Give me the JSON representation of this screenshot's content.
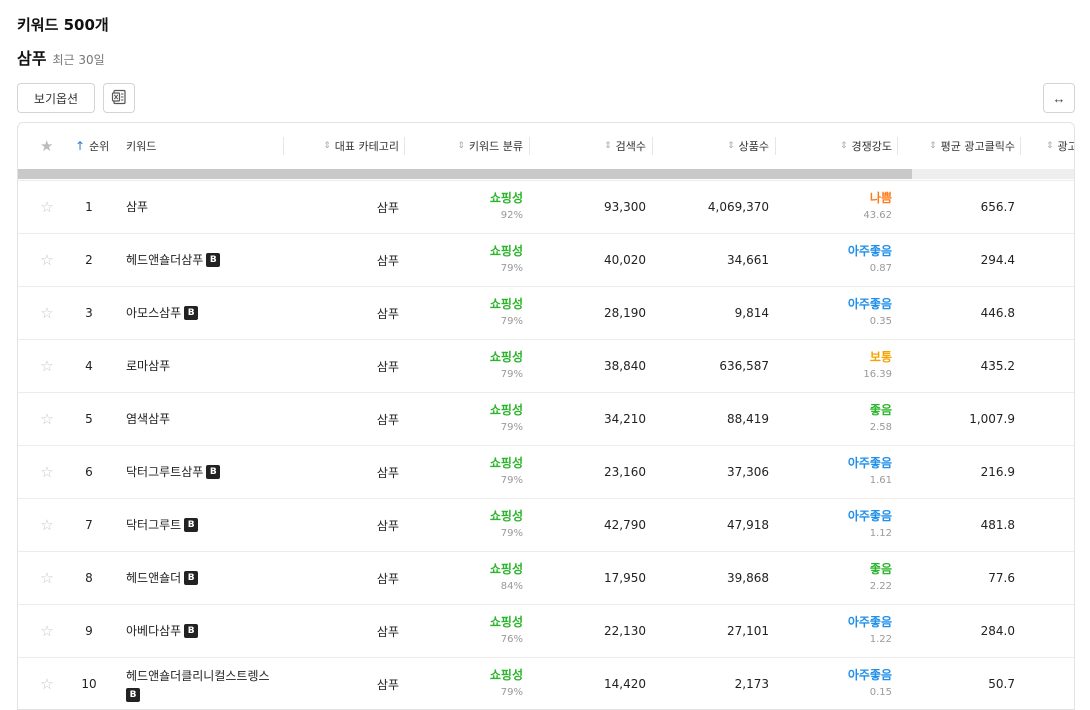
{
  "header": {
    "title": "키워드 500개",
    "keyword": "삼푸",
    "period": "최근 30일"
  },
  "toolbar": {
    "view_options_label": "보기옵션",
    "excel_icon": "excel-icon",
    "expand_label": "↔"
  },
  "columns": {
    "rank": "순위",
    "keyword": "키워드",
    "category": "대표 카테고리",
    "classification": "키워드 분류",
    "search_count": "검색수",
    "product_count": "상품수",
    "competition": "경쟁강도",
    "avg_ad_clicks": "평균 광고클릭수",
    "truncated": "광고"
  },
  "colors": {
    "shopping": "#2bb52b",
    "bad": "#ff7a1a",
    "normal": "#f5a300",
    "good": "#2bb52b",
    "very_good": "#1f8fea",
    "sort_active": "#1f7ae0"
  },
  "scrollbar_fraction": 0.845,
  "rows": [
    {
      "rank": "1",
      "keyword": "삼푸",
      "badge": "",
      "category": "삼푸",
      "class_label": "쇼핑성",
      "class_pct": "92%",
      "search": "93,300",
      "products": "4,069,370",
      "comp_label": "나쁨",
      "comp_value": "43.62",
      "comp_color": "#ff7a1a",
      "ad_clicks": "656.7"
    },
    {
      "rank": "2",
      "keyword": "헤드앤숄더삼푸",
      "badge": "B",
      "category": "삼푸",
      "class_label": "쇼핑성",
      "class_pct": "79%",
      "search": "40,020",
      "products": "34,661",
      "comp_label": "아주좋음",
      "comp_value": "0.87",
      "comp_color": "#1f8fea",
      "ad_clicks": "294.4"
    },
    {
      "rank": "3",
      "keyword": "아모스삼푸",
      "badge": "B",
      "category": "삼푸",
      "class_label": "쇼핑성",
      "class_pct": "79%",
      "search": "28,190",
      "products": "9,814",
      "comp_label": "아주좋음",
      "comp_value": "0.35",
      "comp_color": "#1f8fea",
      "ad_clicks": "446.8"
    },
    {
      "rank": "4",
      "keyword": "로마삼푸",
      "badge": "",
      "category": "삼푸",
      "class_label": "쇼핑성",
      "class_pct": "79%",
      "search": "38,840",
      "products": "636,587",
      "comp_label": "보통",
      "comp_value": "16.39",
      "comp_color": "#f5a300",
      "ad_clicks": "435.2"
    },
    {
      "rank": "5",
      "keyword": "염색삼푸",
      "badge": "",
      "category": "삼푸",
      "class_label": "쇼핑성",
      "class_pct": "79%",
      "search": "34,210",
      "products": "88,419",
      "comp_label": "좋음",
      "comp_value": "2.58",
      "comp_color": "#2bb52b",
      "ad_clicks": "1,007.9"
    },
    {
      "rank": "6",
      "keyword": "닥터그루트삼푸",
      "badge": "B",
      "category": "삼푸",
      "class_label": "쇼핑성",
      "class_pct": "79%",
      "search": "23,160",
      "products": "37,306",
      "comp_label": "아주좋음",
      "comp_value": "1.61",
      "comp_color": "#1f8fea",
      "ad_clicks": "216.9"
    },
    {
      "rank": "7",
      "keyword": "닥터그루트",
      "badge": "B",
      "category": "삼푸",
      "class_label": "쇼핑성",
      "class_pct": "79%",
      "search": "42,790",
      "products": "47,918",
      "comp_label": "아주좋음",
      "comp_value": "1.12",
      "comp_color": "#1f8fea",
      "ad_clicks": "481.8"
    },
    {
      "rank": "8",
      "keyword": "헤드앤숄더",
      "badge": "B",
      "category": "삼푸",
      "class_label": "쇼핑성",
      "class_pct": "84%",
      "search": "17,950",
      "products": "39,868",
      "comp_label": "좋음",
      "comp_value": "2.22",
      "comp_color": "#2bb52b",
      "ad_clicks": "77.6"
    },
    {
      "rank": "9",
      "keyword": "아베다삼푸",
      "badge": "B",
      "category": "삼푸",
      "class_label": "쇼핑성",
      "class_pct": "76%",
      "search": "22,130",
      "products": "27,101",
      "comp_label": "아주좋음",
      "comp_value": "1.22",
      "comp_color": "#1f8fea",
      "ad_clicks": "284.0"
    },
    {
      "rank": "10",
      "keyword": "헤드앤숄더클리니컬스트렝스",
      "badge": "B",
      "category": "삼푸",
      "class_label": "쇼핑성",
      "class_pct": "79%",
      "search": "14,420",
      "products": "2,173",
      "comp_label": "아주좋음",
      "comp_value": "0.15",
      "comp_color": "#1f8fea",
      "ad_clicks": "50.7"
    }
  ]
}
